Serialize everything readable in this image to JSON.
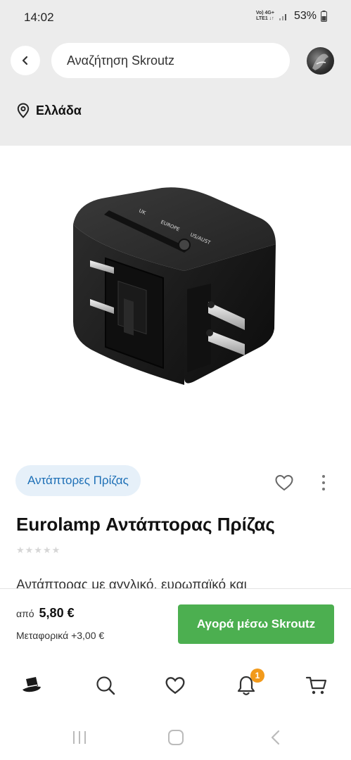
{
  "status_bar": {
    "time": "14:02",
    "network_top": "Vo) 4G+",
    "network_bottom": "LTE1 ↓↑",
    "battery": "53%"
  },
  "header": {
    "search_placeholder": "Αναζήτηση Skroutz",
    "location": "Ελλάδα"
  },
  "product": {
    "category": "Αντάπτορες Πρίζας",
    "title": "Eurolamp Αντάπτορας Πρίζας",
    "rating_stars": 0,
    "description": "Αντάπτορας με αγγλικό, ευρωπαϊκό και",
    "image_labels": {
      "uk": "UK",
      "europe": "EUROPE",
      "us": "US/AUST"
    }
  },
  "buy_bar": {
    "price_prefix": "από",
    "price": "5,80 €",
    "shipping": "Μεταφορικά +3,00 €",
    "button_label": "Αγορά μέσω Skroutz"
  },
  "bottom_nav": {
    "notifications_badge": "1"
  },
  "colors": {
    "accent_green": "#4caf50",
    "chip_text": "#1d6fb6",
    "chip_bg": "#e6f0f9",
    "badge": "#f29a1b",
    "header_bg": "#ececec"
  }
}
